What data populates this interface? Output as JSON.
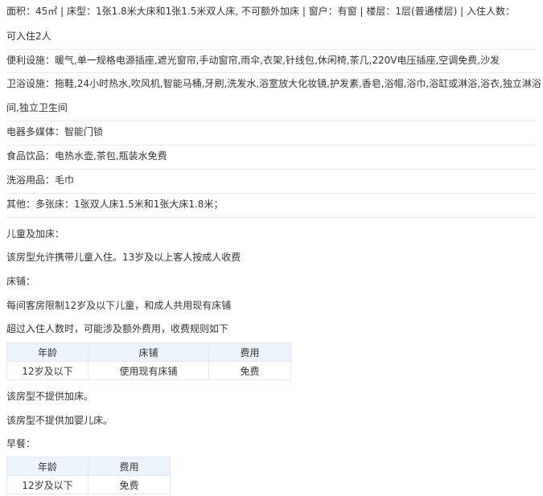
{
  "room_info": {
    "line1": "面积：45㎡ | 床型：1张1.8米大床和1张1.5米双人床, 不可额外加床 | 窗户：有窗 | 楼层：1层(普通楼层) | 入住人数：",
    "line2": "可入住2人"
  },
  "facilities": {
    "convenience": "便利设施：暖气,单一规格电源插座,遮光窗帘,手动窗帘,雨伞,衣架,针线包,休闲椅,茶几,220V电压插座,空调免费,沙发",
    "bathroom_line1": "卫浴设施：拖鞋,24小时热水,吹风机,智能马桶,牙刷,洗发水,浴室放大化妆镜,护发素,香皂,浴帽,浴巾,浴缸或淋浴,浴衣,独立淋浴",
    "bathroom_line2": "间,独立卫生间",
    "electronics": "电器多媒体：智能门锁",
    "food_drink": "食品饮品：电热水壶,茶包,瓶装水免费",
    "toiletries": "洗浴用品：毛巾",
    "other": "其他：多张床：1张双人床1.5米和1张大床1.8米；"
  },
  "children_policy": {
    "heading": "儿童及加床：",
    "allowed": "该房型允许携带儿童入住。13岁及以上客人按成人收费",
    "bed_heading": "床铺：",
    "bed_rule": "每间客房限制12岁及以下儿童，和成人共用现有床铺",
    "extra_fee_note": "超过入住人数时，可能涉及额外费用，收费规则如下",
    "bed_table": {
      "headers": [
        "年龄",
        "床铺",
        "费用"
      ],
      "rows": [
        [
          "12岁及以下",
          "使用现有床铺",
          "免费"
        ]
      ]
    },
    "no_extra_bed": "该房型不提供加床。",
    "no_crib": "该房型不提供加婴儿床。"
  },
  "breakfast": {
    "heading": "早餐：",
    "table": {
      "headers": [
        "年龄",
        "费用"
      ],
      "rows": [
        [
          "12岁及以下",
          "免费"
        ]
      ]
    }
  },
  "colors": {
    "table_header_bg": "#edf3fb",
    "free_text": "#3d7fd7",
    "divider": "#e6eaf0"
  }
}
